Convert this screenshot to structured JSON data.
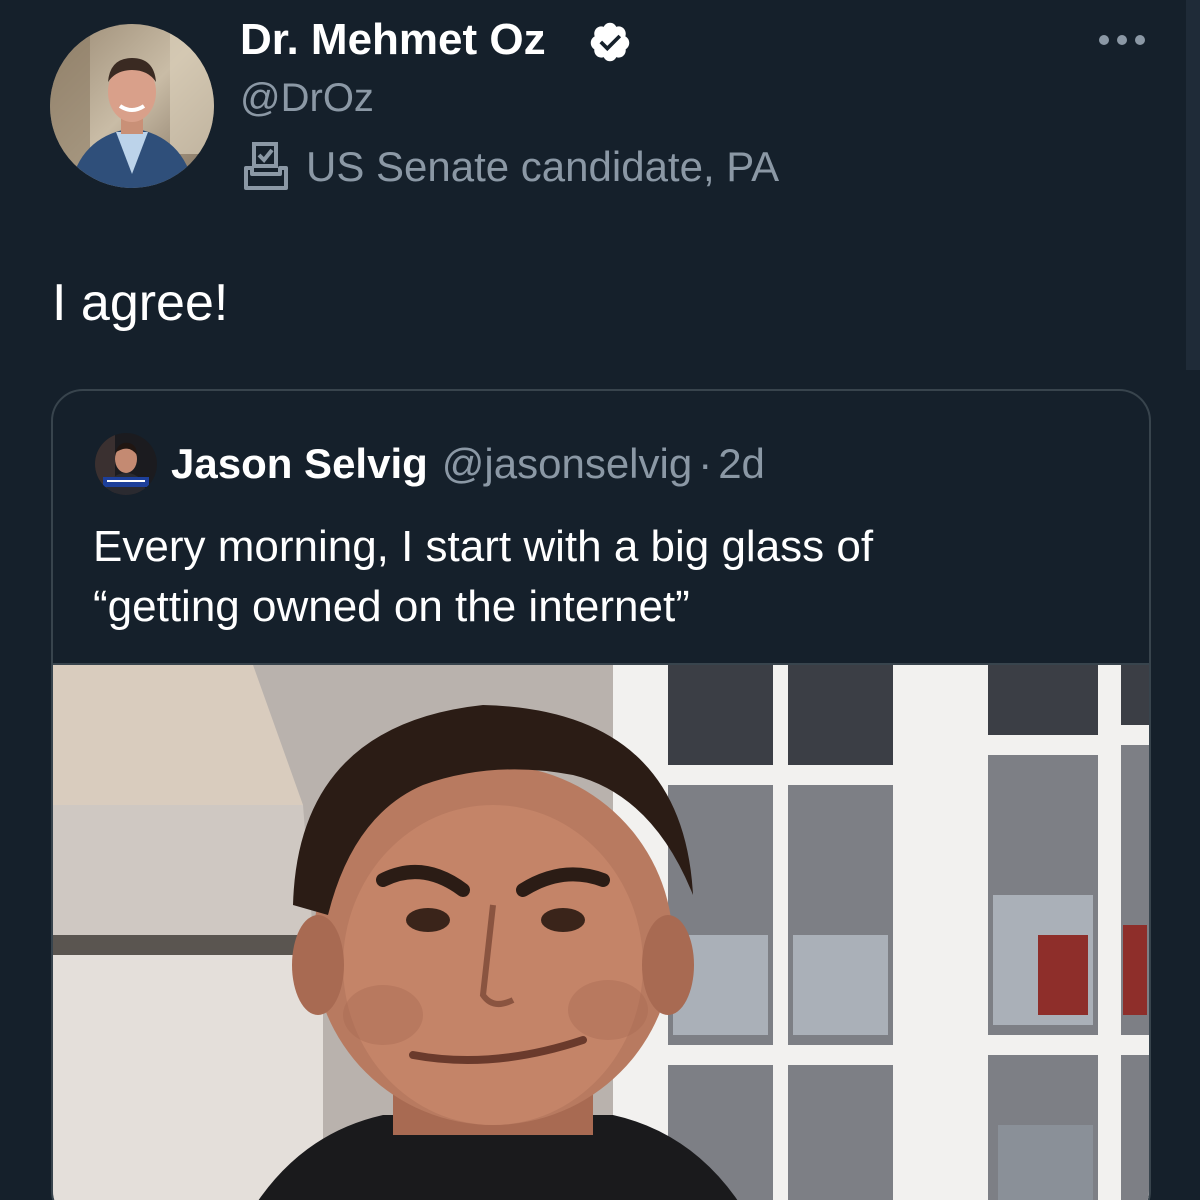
{
  "author": {
    "display_name": "Dr. Mehmet Oz",
    "handle": "@DrOz",
    "label": "US Senate candidate, PA",
    "verified": true
  },
  "tweet": {
    "text": "I agree!"
  },
  "quoted_tweet": {
    "display_name": "Jason Selvig",
    "handle": "@jasonselvig",
    "separator": "·",
    "time": "2d",
    "text_lines": [
      "Every morning, I start with a big glass of",
      "“getting owned on the internet”"
    ]
  },
  "icons": {
    "verified": "verified-badge-icon",
    "label": "ballot-box-icon",
    "more": "more-options-icon"
  },
  "colors": {
    "background": "#15202b",
    "border": "#38444d",
    "secondary_text": "#8b98a5",
    "primary_text": "#ffffff"
  }
}
